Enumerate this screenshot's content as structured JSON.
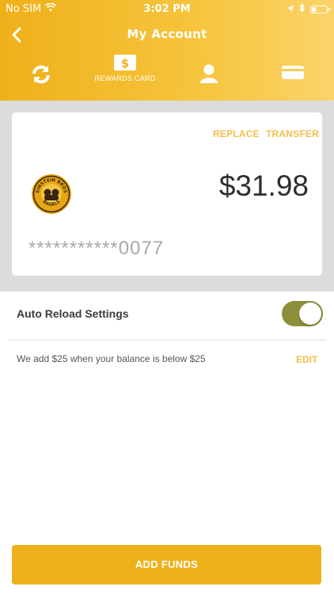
{
  "status_bar": {
    "carrier": "No SIM",
    "time": "3:02 PM"
  },
  "header": {
    "title": "My Account"
  },
  "tabs": [
    {
      "icon": "reload-icon",
      "label": ""
    },
    {
      "icon": "dollar-card-icon",
      "label": "REWARDS CARD"
    },
    {
      "icon": "profile-icon",
      "label": ""
    },
    {
      "icon": "credit-card-icon",
      "label": ""
    }
  ],
  "card": {
    "replace_label": "REPLACE",
    "transfer_label": "TRANSFER",
    "logo_text_top": "EINSTEIN BROS",
    "logo_text_bottom": "BAGELS",
    "balance": "$31.98",
    "number": "***********0077"
  },
  "auto_reload": {
    "label": "Auto Reload Settings",
    "enabled": true,
    "description": "We add $25 when your balance is below $25",
    "edit_label": "EDIT"
  },
  "actions": {
    "add_funds_label": "ADD FUNDS"
  },
  "colors": {
    "accent": "#edb11b",
    "link": "#f1c04d",
    "toggle_on": "#8c8f3a"
  }
}
